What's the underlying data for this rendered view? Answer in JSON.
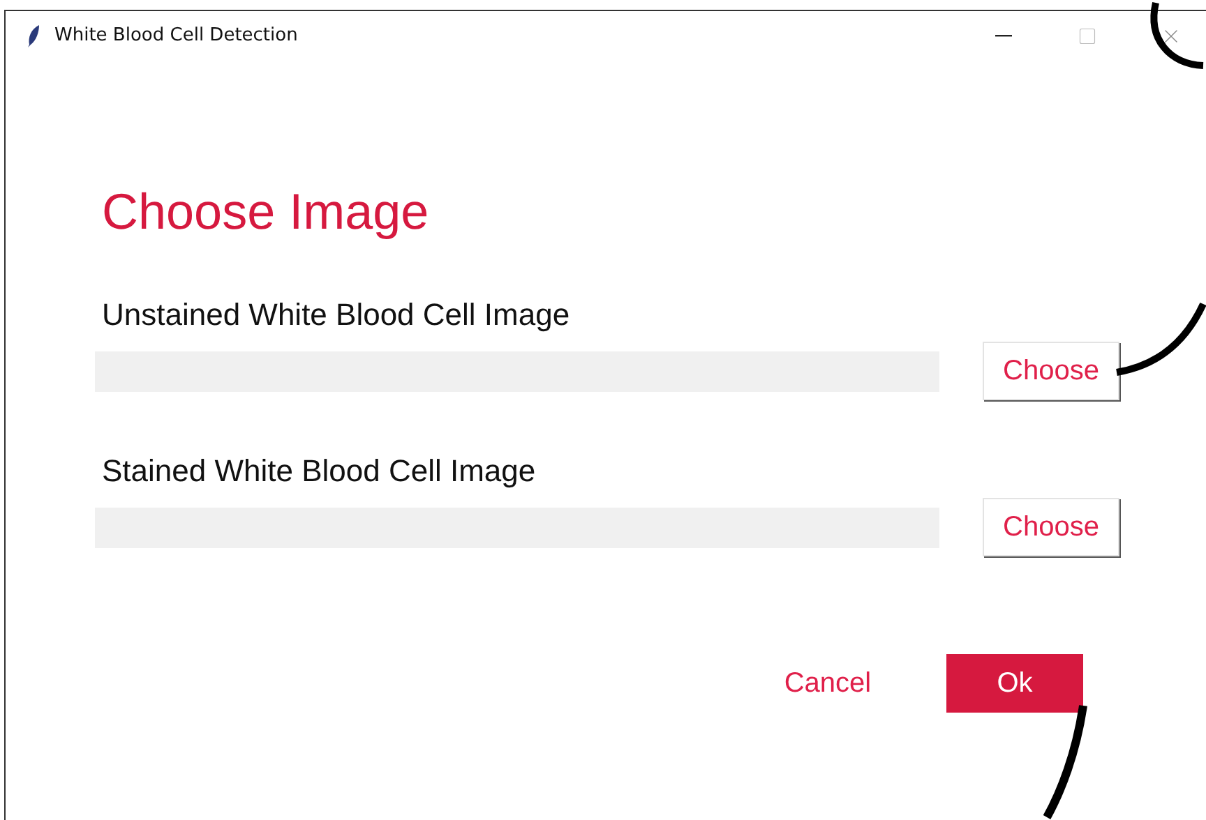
{
  "window": {
    "title": "White Blood Cell Detection"
  },
  "heading": "Choose Image",
  "sections": [
    {
      "label": "Unstained White Blood Cell Image",
      "button": "Choose"
    },
    {
      "label": "Stained White Blood Cell Image",
      "button": "Choose"
    }
  ],
  "actions": {
    "cancel": "Cancel",
    "ok": "Ok"
  }
}
